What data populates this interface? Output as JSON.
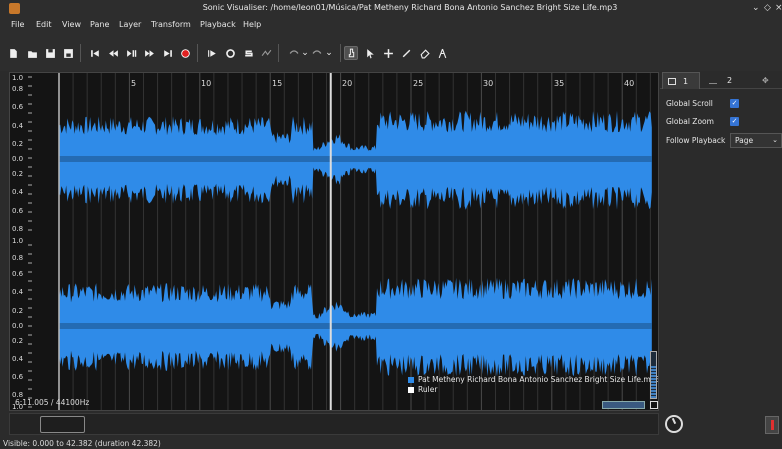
{
  "window": {
    "title": "Sonic Visualiser: /home/leon01/Música/Pat Metheny Richard Bona Antonio Sanchez Bright Size Life.mp3",
    "controls": [
      "chevron-down-icon",
      "restore-icon",
      "close-icon"
    ]
  },
  "menu": [
    "File",
    "Edit",
    "View",
    "Pane",
    "Layer",
    "Transform",
    "Playback",
    "Help"
  ],
  "toolbar": {
    "buttons": [
      "new-file-icon",
      "open-file-icon",
      "save-icon",
      "save-as-icon",
      "rewind-start-icon",
      "rewind-icon",
      "play-pause-icon",
      "fast-forward-icon",
      "fast-forward-end-icon",
      "record-icon",
      "play-selection-icon",
      "loop-icon",
      "solo-icon",
      "follow-playback-icon",
      "undo-icon",
      "redo-icon",
      "navigate-icon",
      "select-icon",
      "move-icon",
      "draw-icon",
      "erase-icon",
      "measure-icon"
    ]
  },
  "pane": {
    "ruler_ticks": [
      "5",
      "10",
      "15",
      "20",
      "25",
      "30",
      "35",
      "40"
    ],
    "scale_labels": [
      "1.0",
      "0.8",
      "0.6",
      "0.4",
      "0.2",
      "0.0",
      "0.2",
      "0.4",
      "0.6",
      "0.8",
      "1.0",
      "0.8",
      "0.6",
      "0.4",
      "0.2",
      "0.0",
      "0.2",
      "0.4",
      "0.6",
      "0.8",
      "1.0"
    ],
    "legend": {
      "waveform": "Pat Metheny Richard Bona Antonio Sanchez Bright Size Life.mp3:...",
      "ruler": "Ruler"
    },
    "info": "6:11.005 / 44100Hz",
    "colors": {
      "waveform": "#2f8be8",
      "background": "#141414",
      "ruler_text": "#dddddd"
    }
  },
  "sidebar": {
    "tabs": [
      "1",
      "2"
    ],
    "global_scroll_label": "Global Scroll",
    "global_scroll_checked": true,
    "global_zoom_label": "Global Zoom",
    "global_zoom_checked": true,
    "follow_playback_label": "Follow Playback",
    "follow_playback_value": "Page"
  },
  "status": {
    "text": "Visible: 0.000 to 42.382 (duration 42.382)"
  }
}
